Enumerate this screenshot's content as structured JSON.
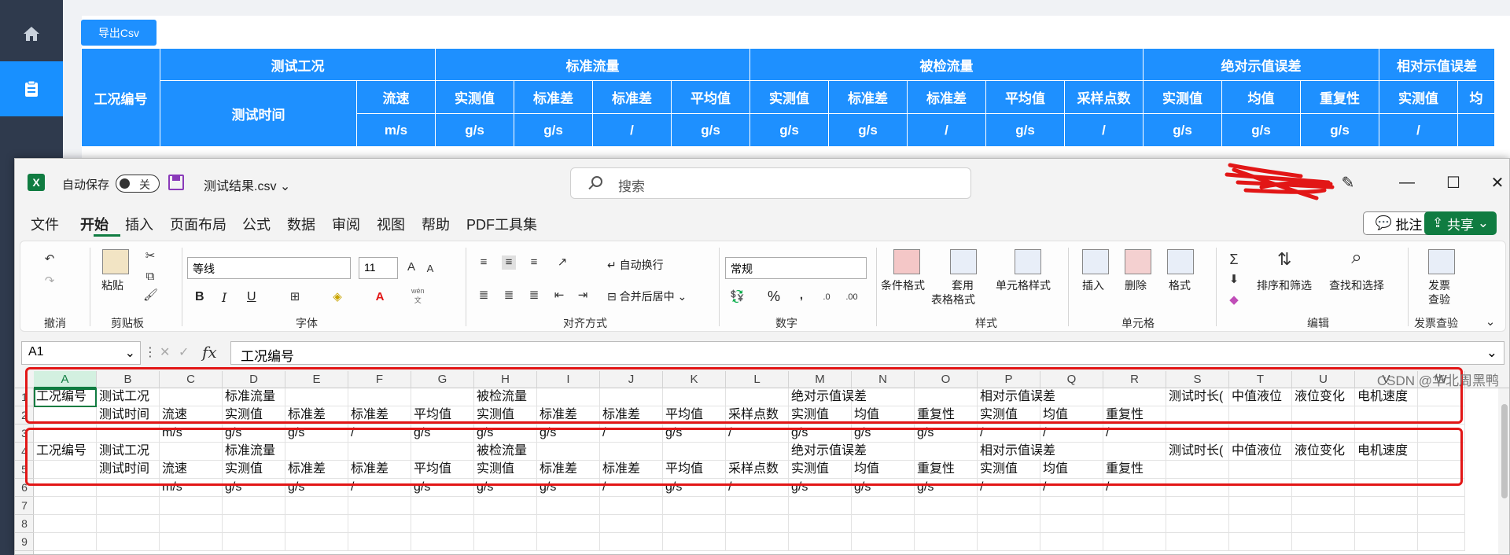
{
  "web": {
    "export_button": "导出Csv",
    "table": {
      "row1": [
        "工况编号",
        "测试工况",
        "标准流量",
        "被检流量",
        "绝对示值误差",
        "相对示值误差"
      ],
      "row2": [
        "测试时间",
        "流速",
        "实测值",
        "标准差",
        "标准差",
        "平均值",
        "实测值",
        "标准差",
        "标准差",
        "平均值",
        "采样点数",
        "实测值",
        "均值",
        "重复性",
        "实测值",
        "均"
      ],
      "row3": [
        "m/s",
        "g/s",
        "g/s",
        "/",
        "g/s",
        "g/s",
        "g/s",
        "/",
        "g/s",
        "/",
        "g/s",
        "g/s",
        "g/s",
        "/",
        ""
      ]
    }
  },
  "excel": {
    "autosave_label": "自动保存",
    "autosave_state": "关",
    "filename": "测试结果.csv",
    "search_placeholder": "搜索",
    "menu": [
      "文件",
      "开始",
      "插入",
      "页面布局",
      "公式",
      "数据",
      "审阅",
      "视图",
      "帮助",
      "PDF工具集"
    ],
    "comment_button": "批注",
    "share_button": "共享",
    "ribbon": {
      "paste": "粘贴",
      "clipboard": "剪贴板",
      "undo": "撤消",
      "font_name": "等线",
      "font_size": "11",
      "font_group": "字体",
      "wrap_text": "自动换行",
      "merge_center": "合并后居中",
      "alignment_group": "对齐方式",
      "number_format": "常规",
      "number_group": "数字",
      "conditional_format": "条件格式",
      "table_format_1": "套用",
      "table_format_2": "表格格式",
      "cell_style": "单元格样式",
      "styles_group": "样式",
      "insert": "插入",
      "delete": "删除",
      "format": "格式",
      "cells_group": "单元格",
      "sort_filter": "排序和筛选",
      "find_select": "查找和选择",
      "editing_group": "编辑",
      "invoice_check_1": "发票",
      "invoice_check_2": "查验",
      "invoice_group": "发票查验",
      "bold": "B",
      "italic": "I",
      "underline": "U",
      "percent": "%",
      "wen": "wén",
      "wen2": "文"
    },
    "name_box": "A1",
    "formula": "工况编号",
    "columns": [
      "A",
      "B",
      "C",
      "D",
      "E",
      "F",
      "G",
      "H",
      "I",
      "J",
      "K",
      "L",
      "M",
      "N",
      "O",
      "P",
      "Q",
      "R",
      "S",
      "T",
      "U",
      "V",
      "W"
    ],
    "rows": [
      "1",
      "2",
      "3",
      "4",
      "5",
      "6",
      "7",
      "8",
      "9"
    ],
    "cells": {
      "r1": [
        "工况编号",
        "测试工况",
        "",
        "标准流量",
        "",
        "",
        "",
        "被检流量",
        "",
        "",
        "",
        "",
        "绝对示值误差",
        "",
        "",
        "相对示值误差",
        "",
        "",
        "测试时长(",
        "中值液位",
        "液位变化",
        "电机速度"
      ],
      "r2": [
        "",
        "测试时间",
        "流速",
        "实测值",
        "标准差",
        "标准差",
        "平均值",
        "实测值",
        "标准差",
        "标准差",
        "平均值",
        "采样点数",
        "实测值",
        "均值",
        "重复性",
        "实测值",
        "均值",
        "重复性",
        "",
        "",
        "",
        ""
      ],
      "r3": [
        "",
        "",
        "m/s",
        "g/s",
        "g/s",
        "/",
        "g/s",
        "g/s",
        "g/s",
        "/",
        "g/s",
        "/",
        "g/s",
        "g/s",
        "g/s",
        "/",
        "/",
        "/",
        "",
        "",
        "",
        ""
      ],
      "r4": [
        "工况编号",
        "测试工况",
        "",
        "标准流量",
        "",
        "",
        "",
        "被检流量",
        "",
        "",
        "",
        "",
        "绝对示值误差",
        "",
        "",
        "相对示值误差",
        "",
        "",
        "测试时长(",
        "中值液位",
        "液位变化",
        "电机速度"
      ],
      "r5": [
        "",
        "测试时间",
        "流速",
        "实测值",
        "标准差",
        "标准差",
        "平均值",
        "实测值",
        "标准差",
        "标准差",
        "平均值",
        "采样点数",
        "实测值",
        "均值",
        "重复性",
        "实测值",
        "均值",
        "重复性",
        "",
        "",
        "",
        ""
      ],
      "r6": [
        "",
        "",
        "m/s",
        "g/s",
        "g/s",
        "/",
        "g/s",
        "g/s",
        "g/s",
        "/",
        "g/s",
        "/",
        "g/s",
        "g/s",
        "g/s",
        "/",
        "/",
        "/",
        "",
        "",
        "",
        ""
      ]
    }
  },
  "watermark": "CSDN @华北周黑鸭",
  "colors": {
    "web_blue": "#1e90ff",
    "excel_green": "#107c41",
    "highlight_red": "#e21616"
  }
}
